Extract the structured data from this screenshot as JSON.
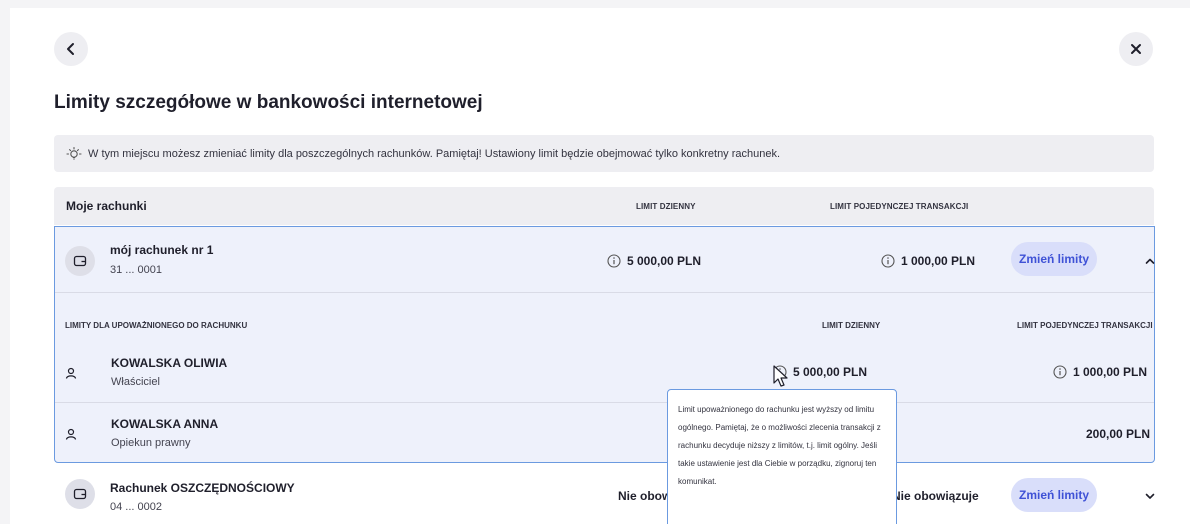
{
  "page": {
    "title": "Limity szczegółowe w bankowości internetowej",
    "info": "W tym miejscu możesz zmieniać limity dla poszczególnych rachunków. Pamiętaj! Ustawiony limit będzie obejmować tylko konkretny rachunek."
  },
  "table_header": {
    "title": "Moje rachunki",
    "col_daily": "LIMIT DZIENNY",
    "col_single": "LIMIT POJEDYNCZEJ TRANSAKCJI"
  },
  "accounts": [
    {
      "name": "mój rachunek nr 1",
      "number": "31 ... 0001",
      "daily_limit": "5 000,00 PLN",
      "single_limit": "1 000,00 PLN",
      "button": "Zmień limity",
      "expanded": true,
      "authorized": {
        "header": "LIMITY DLA UPOWAŻNIONEGO DO RACHUNKU",
        "col_daily": "LIMIT DZIENNY",
        "col_single": "LIMIT POJEDYNCZEJ TRANSAKCJI",
        "users": [
          {
            "name": "KOWALSKA OLIWIA",
            "role": "Właściciel",
            "daily_limit": "5 000,00 PLN",
            "single_limit": "1 000,00 PLN"
          },
          {
            "name": "KOWALSKA ANNA",
            "role": "Opiekun prawny",
            "daily_limit": "",
            "single_limit": "200,00 PLN"
          }
        ]
      }
    },
    {
      "name": "Rachunek OSZCZĘDNOŚCIOWY",
      "number": "04 ... 0002",
      "daily_limit": "Nie obowiązuje",
      "single_limit": "Nie obowiązuje",
      "button": "Zmień limity",
      "expanded": false
    }
  ],
  "tooltip": {
    "text": "Limit upoważnionego do rachunku jest wyższy od limitu ogólnego. Pamiętaj, że o możliwości zlecenia transakcji z rachunku decyduje niższy z limitów, t.j. limit ogólny. Jeśli takie ustawienie jest dla Ciebie w porządku, zignoruj ten komunikat."
  },
  "icons": {
    "back": "chevron-left-icon",
    "close": "close-icon",
    "info": "lightbulb-icon",
    "wallet": "wallet-icon",
    "info_circle": "info-circle-icon",
    "person": "person-icon",
    "collapse": "chevron-up-icon",
    "expand": "chevron-down-icon"
  },
  "colors": {
    "accent": "#3f52d6",
    "button_bg": "#d9defa",
    "border_focus": "#6b9ae0",
    "panel_bg": "#eeeef2"
  }
}
